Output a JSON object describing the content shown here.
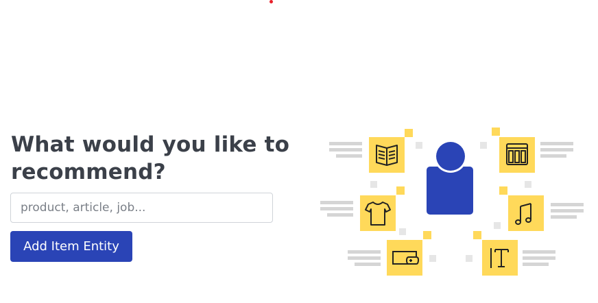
{
  "hero": {
    "heading": "What would you like to recommend?",
    "input_placeholder": "product, article, job...",
    "add_button_label": "Add Item Entity"
  },
  "illustration": {
    "colors": {
      "tile": "#ffd95a",
      "person": "#2a44b6",
      "lines": "#d5d5d5",
      "squares": "#e6e6e6",
      "stroke": "#222222"
    },
    "icons": [
      "book-icon",
      "web-layout-icon",
      "tshirt-icon",
      "music-note-icon",
      "gaming-monitor-icon",
      "text-icon",
      "user-icon"
    ]
  }
}
